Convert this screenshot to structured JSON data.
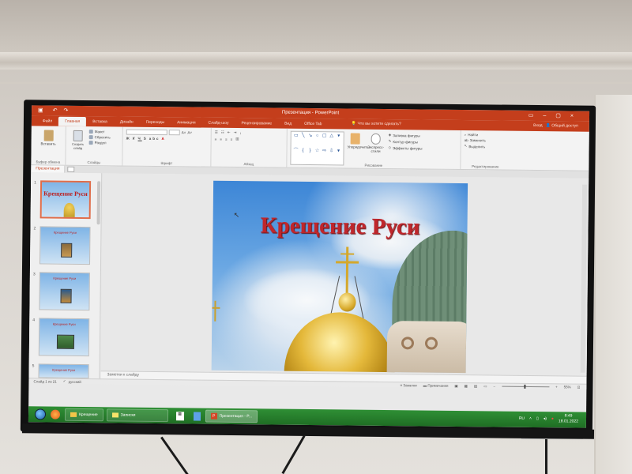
{
  "window": {
    "title": "Презентация - PowerPoint",
    "tabs": [
      "Файл",
      "Главная",
      "Вставка",
      "Дизайн",
      "Переходы",
      "Анимация",
      "Слайд-шоу",
      "Рецензирование",
      "Вид",
      "Office Tab"
    ],
    "tell_me": "Что вы хотите сделать?",
    "sign_in": "Вход",
    "share": "Общий доступ"
  },
  "ribbon": {
    "clipboard": {
      "paste": "Вставить",
      "label": "Буфер обмена"
    },
    "slides": {
      "new_slide": "Создать слайд",
      "layout": "Макет",
      "reset": "Сбросить",
      "section": "Раздел",
      "label": "Слайды"
    },
    "font": {
      "label": "Шрифт"
    },
    "paragraph": {
      "label": "Абзац"
    },
    "drawing": {
      "arrange": "Упорядочить",
      "quick_styles": "Экспресс-стили",
      "fill": "Заливка фигуры",
      "outline": "Контур фигуры",
      "effects": "Эффекты фигуры",
      "label": "Рисование"
    },
    "editing": {
      "find": "Найти",
      "replace": "Заменить",
      "select": "Выделить",
      "label": "Редактирование"
    }
  },
  "doc_tab": "Презентация",
  "slide": {
    "title": "Крещение Руси"
  },
  "thumbnails": [
    {
      "num": "1",
      "title": "Крещение Руси"
    },
    {
      "num": "2",
      "title": "Крещение Руси"
    },
    {
      "num": "3",
      "title": "Крещение Руси"
    },
    {
      "num": "4",
      "title": "Крещение Руси"
    },
    {
      "num": "5",
      "title": "Крещение Руси"
    }
  ],
  "notes_placeholder": "Заметки к слайду",
  "status": {
    "slide_info": "Слайд 1 из 21",
    "language": "русский",
    "notes": "Заметки",
    "comments": "Примечания",
    "zoom": "55%"
  },
  "taskbar": {
    "apps": [
      {
        "label": "Крещение"
      },
      {
        "label": "Записки"
      },
      {
        "label": "Презентация - P..."
      }
    ],
    "lang": "RU",
    "time": "8:49",
    "date": "18.01.2022"
  },
  "colors": {
    "accent": "#c43e1c",
    "taskbar": "#2f8f35",
    "title_text": "#c0262b"
  }
}
